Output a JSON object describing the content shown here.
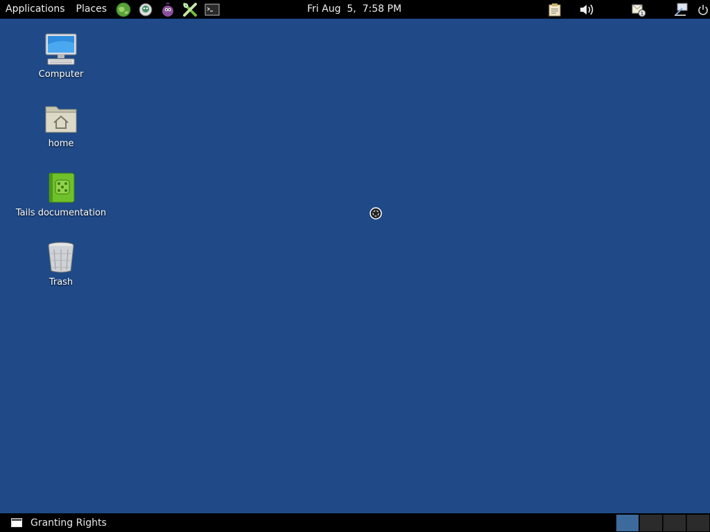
{
  "top_panel": {
    "menus": [
      "Applications",
      "Places"
    ],
    "launchers": [
      "web-browser-icon",
      "pidgin-messenger-icon",
      "tor-onion-icon",
      "keepassx-tools-icon",
      "terminal-icon"
    ],
    "clock": "Fri Aug  5,  7:58 PM",
    "tray": [
      "clipboard-icon",
      "volume-icon",
      "notification-icon",
      "network-icon",
      "power-icon"
    ]
  },
  "desktop": {
    "icons": [
      {
        "label": "Computer",
        "icon": "computer-icon"
      },
      {
        "label": "home",
        "icon": "home-folder-icon"
      },
      {
        "label": "Tails documentation",
        "icon": "documentation-book-icon"
      },
      {
        "label": "Trash",
        "icon": "trash-icon"
      }
    ]
  },
  "bottom_panel": {
    "task": "Granting Rights",
    "workspaces": 4,
    "active_workspace": 1
  },
  "colors": {
    "desktop_bg": "#1f4a87",
    "panel_bg": "#000000",
    "active_workspace": "#3c6a9c"
  }
}
